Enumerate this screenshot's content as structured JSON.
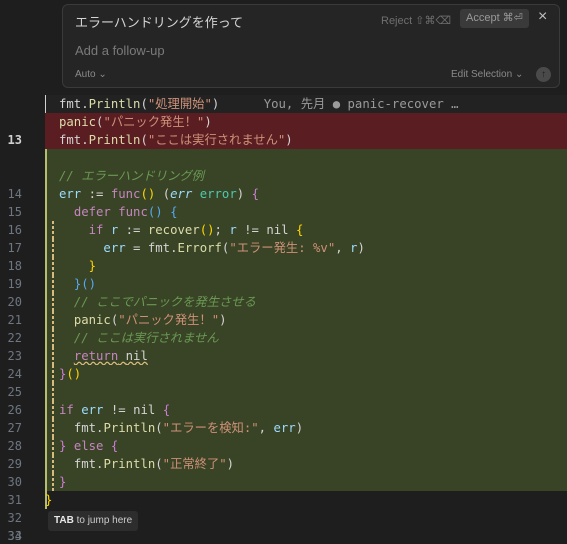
{
  "chat": {
    "title": "エラーハンドリングを作って",
    "reject_label": "Reject ⇧⌘⌫",
    "accept_label": "Accept ⌘⏎",
    "close_icon": "×",
    "followup_placeholder": "Add a follow-up",
    "mode": "Auto",
    "edit_selection": "Edit Selection",
    "send_icon": "↑"
  },
  "editor": {
    "line_numbers": [
      "13",
      "",
      "",
      "14",
      "15",
      "16",
      "17",
      "18",
      "19",
      "20",
      "21",
      "22",
      "23",
      "24",
      "25",
      "26",
      "27",
      "28",
      "29",
      "30",
      "31",
      "32",
      "33",
      "34"
    ],
    "blame": "You, 先月 ● panic-recover …",
    "code": {
      "l13": "fmt.Println(\"処理開始\")",
      "r1": "panic(\"パニック発生！\")",
      "r2": "fmt.Println(\"ここは実行されません\")",
      "c15": "// エラーハンドリング例",
      "c22": "// ここでパニックを発生させる",
      "c24": "// ここは実行されません"
    },
    "tab_hint_key": "TAB",
    "tab_hint_text": " to jump here"
  },
  "colors": {
    "added_bg": "#394325",
    "removed_bg": "#5a1d22",
    "keyword": "#c586c0",
    "string": "#ce9178",
    "comment": "#6a9955"
  }
}
